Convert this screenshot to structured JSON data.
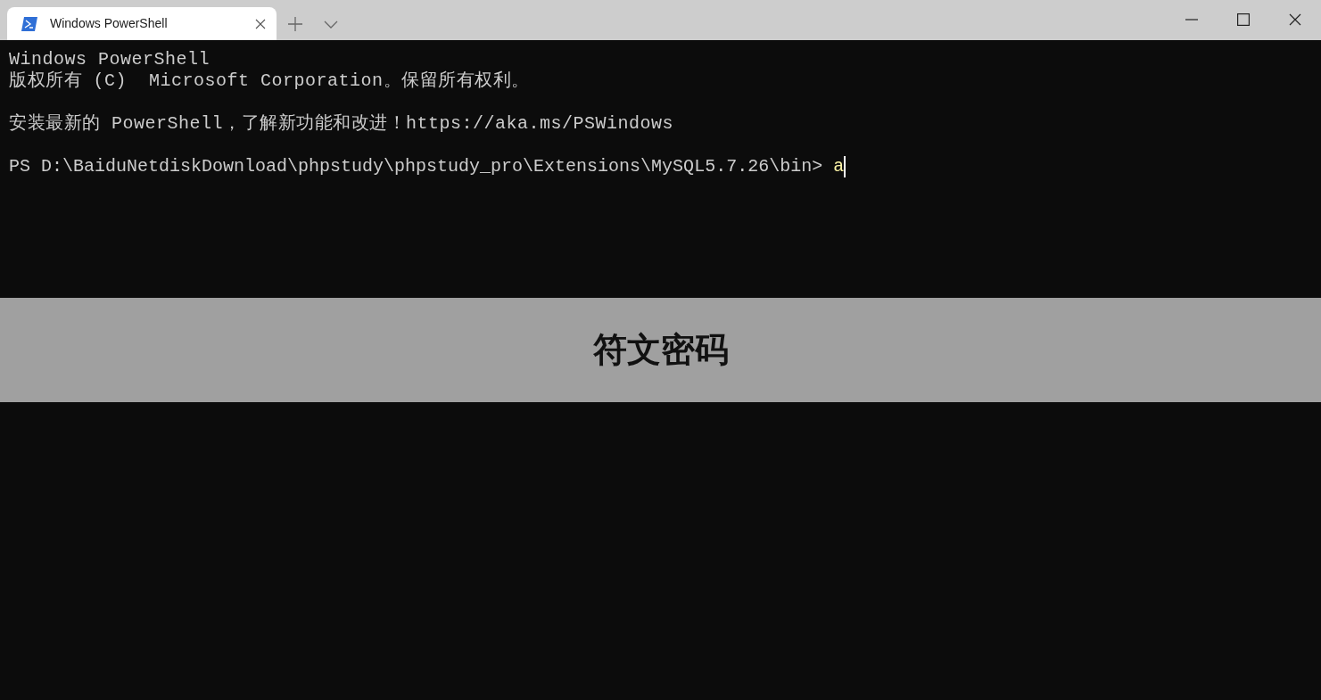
{
  "tabs": [
    {
      "title": "Windows PowerShell",
      "selected": true
    }
  ],
  "terminal": {
    "blocks": [
      [
        "Windows PowerShell",
        "版权所有 (C)  Microsoft Corporation。保留所有权利。"
      ],
      [
        "安装最新的 PowerShell，了解新功能和改进！https://aka.ms/PSWindows"
      ]
    ],
    "prompt": "PS D:\\BaiduNetdiskDownload\\phpstudy\\phpstudy_pro\\Extensions\\MySQL5.7.26\\bin> ",
    "input": "a"
  },
  "banner": {
    "text": "符文密码"
  }
}
